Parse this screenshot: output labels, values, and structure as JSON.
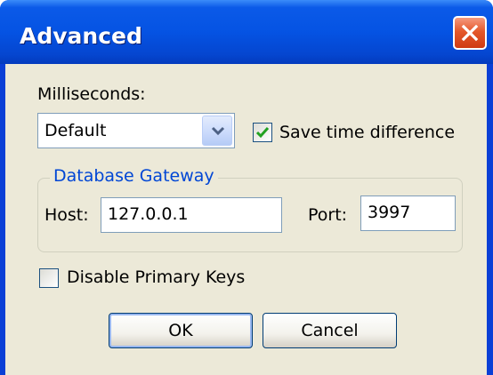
{
  "window": {
    "title": "Advanced",
    "close_icon": "close-icon"
  },
  "milliseconds": {
    "label": "Milliseconds:",
    "selected": "Default",
    "dropdown_icon": "chevron-down-icon"
  },
  "save_time_difference": {
    "label": "Save time difference",
    "checked": true
  },
  "database_gateway": {
    "title": "Database Gateway",
    "host_label": "Host:",
    "host_value": "127.0.0.1",
    "port_label": "Port:",
    "port_value": "3997"
  },
  "disable_primary_keys": {
    "label": "Disable Primary Keys",
    "checked": false
  },
  "buttons": {
    "ok": "OK",
    "cancel": "Cancel"
  },
  "colors": {
    "titlebar": "#0553e3",
    "client_bg": "#ece9d8",
    "group_title": "#0046d5",
    "close_button": "#e4582b",
    "checkmark": "#21a121"
  }
}
